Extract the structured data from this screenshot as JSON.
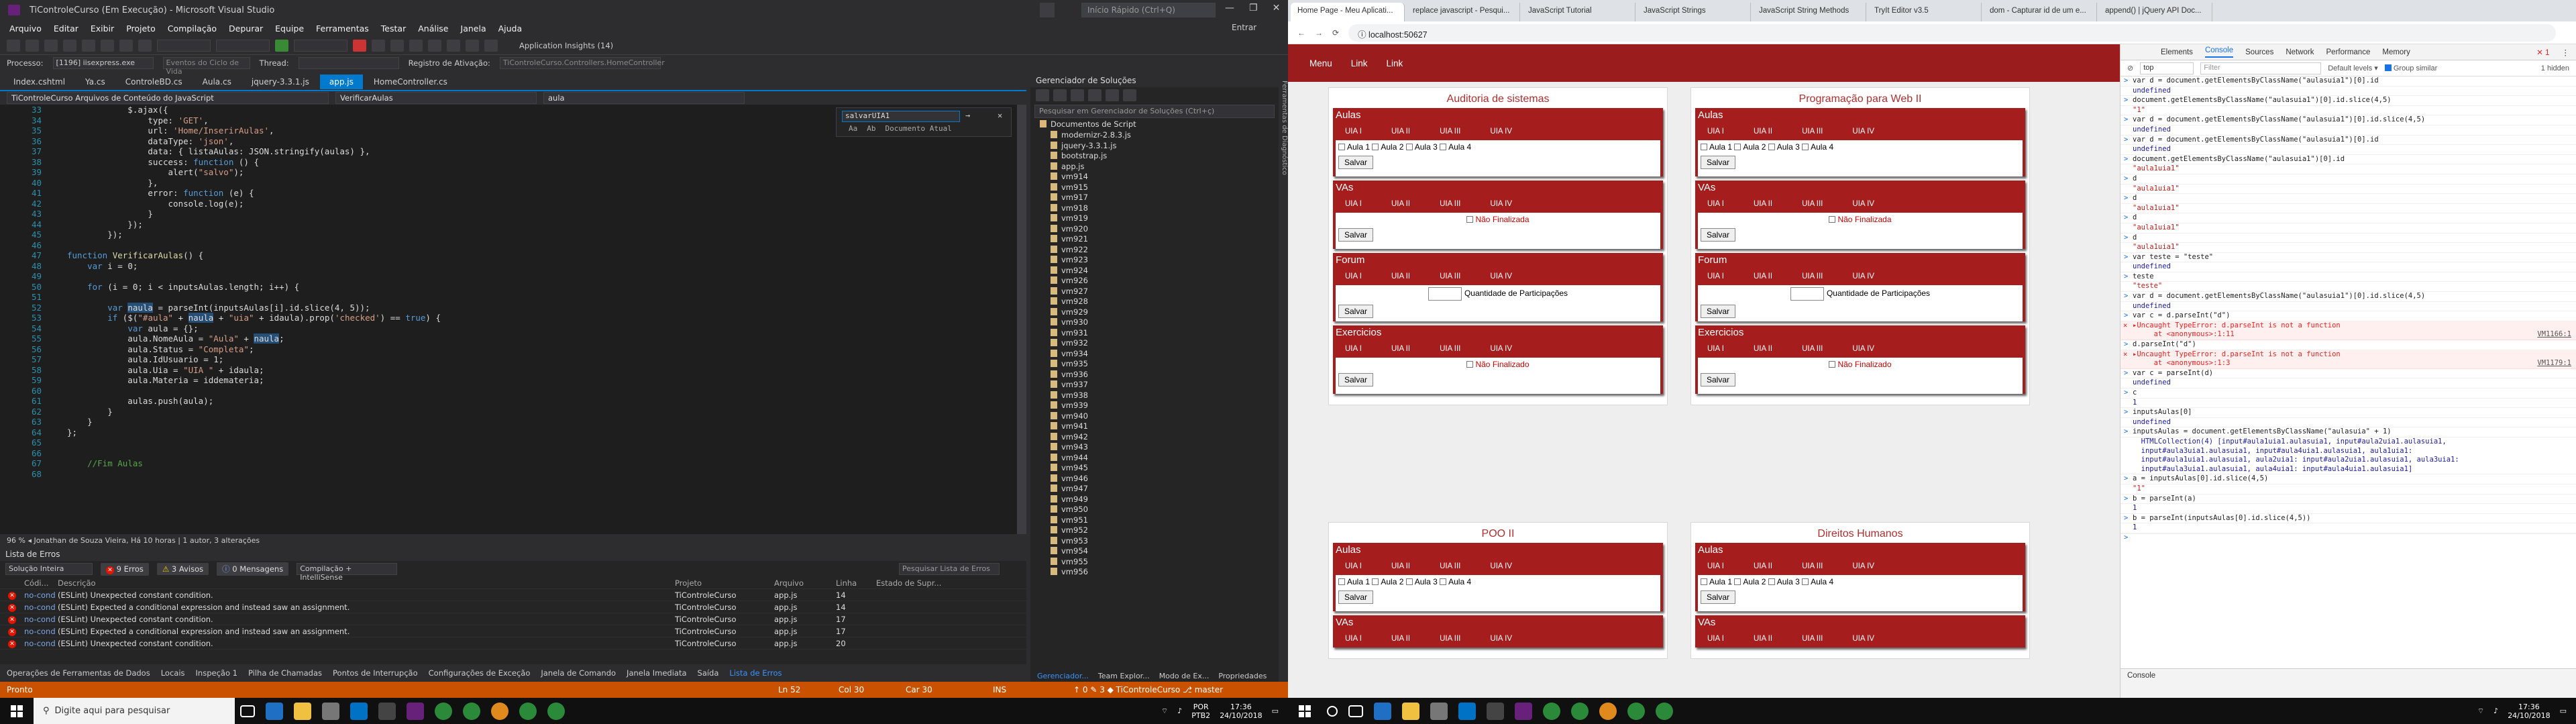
{
  "vs": {
    "title": "TiControleCurso (Em Execução) - Microsoft Visual Studio",
    "quick_launch": "Início Rápido (Ctrl+Q)",
    "window_buttons": [
      "—",
      "❐",
      "✕"
    ],
    "user": "Entrar",
    "menu": [
      "Arquivo",
      "Editar",
      "Exibir",
      "Projeto",
      "Compilação",
      "Depurar",
      "Equipe",
      "Ferramentas",
      "Testar",
      "Análise",
      "Janela",
      "Ajuda"
    ],
    "toolbar_insights": "Application Insights (14)",
    "process_label": "Processo:",
    "process_value": "[1196] iisexpress.exe",
    "toolbar_events": "Eventos do Ciclo de Vida",
    "toolbar_thread": "Thread:",
    "toolbar_stack": "Registro de Ativação:",
    "toolbar_stack_value": "TiControleCurso.Controllers.HomeController",
    "tabs": [
      "Index.cshtml",
      "Ya.cs",
      "ControleBD.cs",
      "Aula.cs",
      "jquery-3.3.1.js",
      "app.js",
      "HomeController.cs"
    ],
    "active_tab": "app.js",
    "nav_left": "TiControleCurso Arquivos de Conteúdo do JavaScript",
    "nav_right": "VerificarAulas",
    "nav_member": "aula",
    "find_value": "salvarUIA1",
    "find_doc": "Documento Atual",
    "status_line": "96 %  ◂  Jonathan de Souza Vieira, Há 10 horas | 1 autor, 3 alterações",
    "error_list": {
      "title": "Lista de Erros",
      "scope": "Solução Inteira",
      "errors_count": "9 Erros",
      "warnings_count": "3 Avisos",
      "messages_count": "0 Mensagens",
      "build": "Compilação + IntelliSense",
      "search": "Pesquisar Lista de Erros",
      "headers": [
        "",
        "Códi...",
        "Descrição",
        "Projeto",
        "Arquivo",
        "Linha",
        "Estado de Supr..."
      ],
      "rows": [
        {
          "code": "no-cond",
          "desc": "(ESLint) Unexpected constant condition.",
          "project": "TiControleCurso",
          "file": "app.js",
          "line": "14"
        },
        {
          "code": "no-cond",
          "desc": "(ESLint) Expected a conditional expression and instead saw an assignment.",
          "project": "TiControleCurso",
          "file": "app.js",
          "line": "14"
        },
        {
          "code": "no-cond",
          "desc": "(ESLint) Unexpected constant condition.",
          "project": "TiControleCurso",
          "file": "app.js",
          "line": "17"
        },
        {
          "code": "no-cond",
          "desc": "(ESLint) Expected a conditional expression and instead saw an assignment.",
          "project": "TiControleCurso",
          "file": "app.js",
          "line": "17"
        },
        {
          "code": "no-cond",
          "desc": "(ESLint) Unexpected constant condition.",
          "project": "TiControleCurso",
          "file": "app.js",
          "line": "20"
        }
      ]
    },
    "bottom_tabs": [
      "Operações de Ferramentas de Dados",
      "Locais",
      "Inspeção 1",
      "Pilha de Chamadas",
      "Pontos de Interrupção",
      "Configurações de Exceção",
      "Janela de Comando",
      "Janela Imediata",
      "Saída",
      "Lista de Erros"
    ],
    "status": {
      "left": "Pronto",
      "ln": "Ln 52",
      "col": "Col 30",
      "car": "Car 30",
      "ins": "INS",
      "branch": "↑ 0   ✎ 3   ◆ TiControleCurso   ⎇ master"
    },
    "code_lines": [
      {
        "n": "33",
        "html": "            $.ajax({"
      },
      {
        "n": "34",
        "html": "                type: <span class=\"s\">'GET'</span>,"
      },
      {
        "n": "35",
        "html": "                url: <span class=\"s\">'Home/InserirAulas'</span>,"
      },
      {
        "n": "36",
        "html": "                dataType: <span class=\"s\">'json'</span>,"
      },
      {
        "n": "37",
        "html": "                data: { listaAulas: JSON.stringify(aulas) },"
      },
      {
        "n": "38",
        "html": "                success: <span class=\"k\">function</span> () {"
      },
      {
        "n": "39",
        "html": "                    alert(<span class=\"s\">\"salvo\"</span>);"
      },
      {
        "n": "40",
        "html": "                },"
      },
      {
        "n": "41",
        "html": "                error: <span class=\"k\">function</span> (e) {"
      },
      {
        "n": "42",
        "html": "                    console.log(e);"
      },
      {
        "n": "43",
        "html": "                }"
      },
      {
        "n": "44",
        "html": "            });"
      },
      {
        "n": "45",
        "html": "        });"
      },
      {
        "n": "46",
        "html": ""
      },
      {
        "n": "47",
        "html": "<span class=\"k\">function</span> <span class=\"f\">VerificarAulas</span>() {"
      },
      {
        "n": "48",
        "html": "    <span class=\"k\">var</span> i = 0;"
      },
      {
        "n": "49",
        "html": ""
      },
      {
        "n": "50",
        "html": "    <span class=\"k\">for</span> (i = 0; i < inputsAulas.length; i++) {"
      },
      {
        "n": "51",
        "html": ""
      },
      {
        "n": "52",
        "html": "        <span class=\"k\">var</span> <span class=\"hl\">naula</span> = parseInt(inputsAulas[i].id.slice(4, 5));"
      },
      {
        "n": "53",
        "html": "        <span class=\"k\">if</span> ($(<span class=\"s\">\"#aula\"</span> + <span class=\"hl\">naula</span> + <span class=\"s\">\"uia\"</span> + idaula).prop(<span class=\"s\">'checked'</span>) == <span class=\"k\">true</span>) {"
      },
      {
        "n": "54",
        "html": "            <span class=\"k\">var</span> aula = {};"
      },
      {
        "n": "55",
        "html": "            aula.NomeAula = <span class=\"s\">\"Aula\"</span> + <span class=\"hl\">naula</span>;"
      },
      {
        "n": "56",
        "html": "            aula.Status = <span class=\"s\">\"Completa\"</span>;"
      },
      {
        "n": "57",
        "html": "            aula.IdUsuario = 1;"
      },
      {
        "n": "58",
        "html": "            aula.Uia = <span class=\"s\">\"UIA \"</span> + idaula;"
      },
      {
        "n": "59",
        "html": "            aula.Materia = iddemateria;"
      },
      {
        "n": "60",
        "html": ""
      },
      {
        "n": "61",
        "html": "            aulas.push(aula);"
      },
      {
        "n": "62",
        "html": "        }"
      },
      {
        "n": "63",
        "html": "    }"
      },
      {
        "n": "64",
        "html": "};"
      },
      {
        "n": "65",
        "html": ""
      },
      {
        "n": "66",
        "html": ""
      },
      {
        "n": "67",
        "html": "    <span class=\"c\">//Fim Aulas</span>"
      },
      {
        "n": "68",
        "html": ""
      }
    ],
    "solution": {
      "title": "Gerenciador de Soluções",
      "search": "Pesquisar em Gerenciador de Soluções (Ctrl+ç)",
      "root": "Documentos de Script",
      "files": [
        "modernizr-2.8.3.js",
        "jquery-3.3.1.js",
        "bootstrap.js",
        "app.js",
        "vm914",
        "vm915",
        "vm917",
        "vm918",
        "vm919",
        "vm920",
        "vm921",
        "vm922",
        "vm923",
        "vm924",
        "vm926",
        "vm927",
        "vm928",
        "vm929",
        "vm930",
        "vm931",
        "vm932",
        "vm934",
        "vm935",
        "vm936",
        "vm937",
        "vm938",
        "vm939",
        "vm940",
        "vm941",
        "vm942",
        "vm943",
        "vm944",
        "vm945",
        "vm946",
        "vm947",
        "vm949",
        "vm950",
        "vm951",
        "vm952",
        "vm953",
        "vm954",
        "vm955",
        "vm956"
      ],
      "bottom_tabs": [
        "Gerenciador...",
        "Team Explor...",
        "Modo de Ex...",
        "Propriedades"
      ]
    },
    "diag": "Ferramentas de Diagnóstico"
  },
  "taskbar": {
    "search_placeholder": "Digite aqui para pesquisar",
    "lang": "POR",
    "lang2": "PTB2",
    "time": "17:36",
    "date": "24/10/2018"
  },
  "chrome": {
    "tabs": [
      "Home Page - Meu Aplicati...",
      "replace javascript - Pesqui...",
      "JavaScript Tutorial",
      "JavaScript Strings",
      "JavaScript String Methods",
      "TryIt Editor v3.5",
      "dom - Capturar id de um e...",
      "append() | jQuery API Doc..."
    ],
    "url": "localhost:50627",
    "nav": [
      "Menu",
      "Link",
      "Link"
    ],
    "units": [
      "UIA I",
      "UIA II",
      "UIA III",
      "UIA IV"
    ],
    "aulas_title": "Aulas",
    "vas_title": "VAs",
    "forum_title": "Forum",
    "exercicios_title": "Exercicios",
    "aula_checks": [
      "Aula 1",
      "Aula 2",
      "Aula 3",
      "Aula 4"
    ],
    "nao_finalizada": "Não Finalizada",
    "nao_finalizado": "Não Finalizado",
    "qtd_participacoes": "Quantidade de Participações",
    "salvar": "Salvar",
    "cards": [
      {
        "title": "Auditoria de sistemas"
      },
      {
        "title": "Programação para Web II"
      },
      {
        "title": "POO II"
      },
      {
        "title": "Direitos Humanos"
      }
    ]
  },
  "devtools": {
    "tabs": [
      "Elements",
      "Console",
      "Sources",
      "Network",
      "Performance",
      "Memory"
    ],
    "active": "Console",
    "errcount": "1",
    "hidden": "1 hidden",
    "context": "top",
    "filter": "Filter",
    "levels": "Default levels ▾",
    "group": "Group similar",
    "drawer": "Console",
    "lines": [
      {
        "t": "in",
        "text": "var d = document.getElementsByClassName(\"aulasuia1\")[0].id"
      },
      {
        "t": "out",
        "text": "undefined"
      },
      {
        "t": "in",
        "text": "document.getElementsByClassName(\"aulasuia1\")[0].id.slice(4,5)"
      },
      {
        "t": "str",
        "text": "\"1\""
      },
      {
        "t": "in",
        "text": "var d = document.getElementsByClassName(\"aulasuia1\")[0].id.slice(4,5)"
      },
      {
        "t": "out",
        "text": "undefined"
      },
      {
        "t": "in",
        "text": "var d = document.getElementsByClassName(\"aulasuia1\")[0].id"
      },
      {
        "t": "out",
        "text": "undefined"
      },
      {
        "t": "in",
        "text": "document.getElementsByClassName(\"aulasuia1\")[0].id"
      },
      {
        "t": "str",
        "text": "\"aula1uia1\""
      },
      {
        "t": "in",
        "text": "d"
      },
      {
        "t": "str",
        "text": "\"aula1uia1\""
      },
      {
        "t": "in",
        "text": "d"
      },
      {
        "t": "str",
        "text": "\"aula1uia1\""
      },
      {
        "t": "in",
        "text": "d"
      },
      {
        "t": "str",
        "text": "\"aula1uia1\""
      },
      {
        "t": "in",
        "text": "d"
      },
      {
        "t": "str",
        "text": "\"aula1uia1\""
      },
      {
        "t": "in",
        "text": "var teste = \"teste\""
      },
      {
        "t": "out",
        "text": "undefined"
      },
      {
        "t": "in",
        "text": "teste"
      },
      {
        "t": "str",
        "text": "\"teste\""
      },
      {
        "t": "in",
        "text": "var d = document.getElementsByClassName(\"aulasuia1\")[0].id.slice(4,5)"
      },
      {
        "t": "out",
        "text": "undefined"
      },
      {
        "t": "in",
        "text": "var c = d.parseInt(\"d\")"
      },
      {
        "t": "err",
        "text": "▸Uncaught TypeError: d.parseInt is not a function\n     at <anonymous>:1:11",
        "src": "VM1166:1"
      },
      {
        "t": "in",
        "text": "d.parseInt(\"d\")"
      },
      {
        "t": "err",
        "text": "▸Uncaught TypeError: d.parseInt is not a function\n     at <anonymous>:1:3",
        "src": "VM1179:1"
      },
      {
        "t": "in",
        "text": "var c = parseInt(d)"
      },
      {
        "t": "out",
        "text": "undefined"
      },
      {
        "t": "in",
        "text": "c"
      },
      {
        "t": "out",
        "text": "1"
      },
      {
        "t": "in",
        "text": "inputsAulas[0]"
      },
      {
        "t": "out",
        "text": "undefined"
      },
      {
        "t": "in",
        "text": "inputsAulas = document.getElementsByClassName(\"aulasuia\" + 1)"
      },
      {
        "t": "out",
        "text": "  HTMLCollection(4) [input#aula1uia1.aulasuia1, input#aula2uia1.aulasuia1,\n  input#aula3uia1.aulasuia1, input#aula4uia1.aulasuia1, aula1uia1:\n  input#aula1uia1.aulasuia1, aula2uia1: input#aula2uia1.aulasuia1, aula3uia1:\n  input#aula3uia1.aulasuia1, aula4uia1: input#aula4uia1.aulasuia1]"
      },
      {
        "t": "in",
        "text": "a = inputsAulas[0].id.slice(4,5)"
      },
      {
        "t": "str",
        "text": "\"1\""
      },
      {
        "t": "in",
        "text": "b = parseInt(a)"
      },
      {
        "t": "out",
        "text": "1"
      },
      {
        "t": "in",
        "text": "b = parseInt(inputsAulas[0].id.slice(4,5))"
      },
      {
        "t": "out",
        "text": "1"
      },
      {
        "t": "in",
        "text": ""
      }
    ]
  }
}
